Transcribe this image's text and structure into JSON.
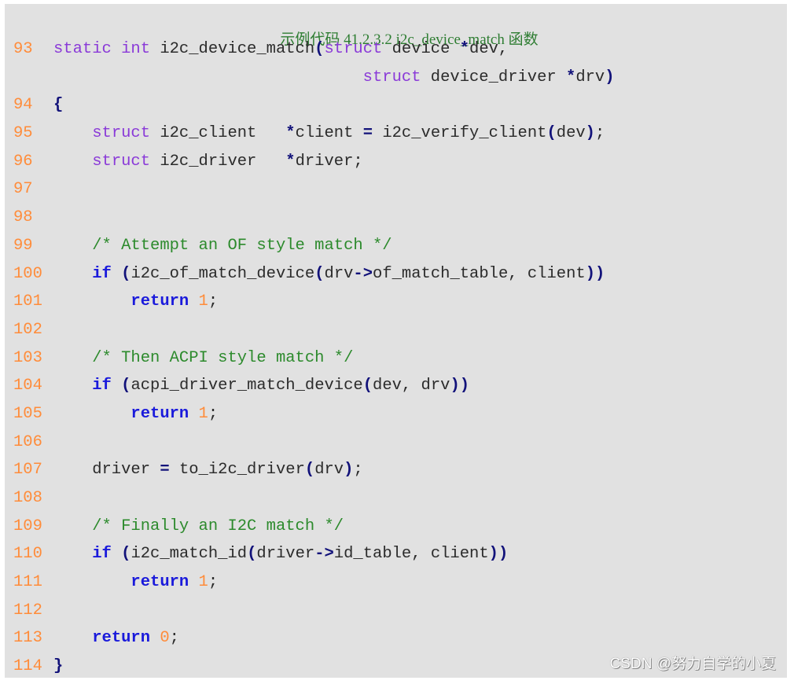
{
  "caption": "示例代码 41.2.3.2 i2c_device_match 函数",
  "watermark": "CSDN @努力自学的小夏",
  "colors": {
    "background": "#e1e1e1",
    "line_number": "#ff8c3a",
    "type_keyword": "#8a3ad8",
    "control_keyword": "#1a1adb",
    "operator": "#12127a",
    "comment": "#2c8a2c",
    "caption": "#2e7d32"
  },
  "lines": [
    {
      "num": "93",
      "tokens": [
        {
          "t": "static int",
          "c": "kw-type"
        },
        {
          "t": " i2c_device_match",
          "c": ""
        },
        {
          "t": "(",
          "c": "op"
        },
        {
          "t": "struct",
          "c": "kw-type"
        },
        {
          "t": " device ",
          "c": ""
        },
        {
          "t": "*",
          "c": "op"
        },
        {
          "t": "dev,",
          "c": ""
        }
      ]
    },
    {
      "num": "",
      "tokens": [
        {
          "t": "                                ",
          "c": ""
        },
        {
          "t": "struct",
          "c": "kw-type"
        },
        {
          "t": " device_driver ",
          "c": ""
        },
        {
          "t": "*",
          "c": "op"
        },
        {
          "t": "drv",
          "c": ""
        },
        {
          "t": ")",
          "c": "op"
        }
      ]
    },
    {
      "num": "94",
      "tokens": [
        {
          "t": "{",
          "c": "op"
        }
      ]
    },
    {
      "num": "95",
      "tokens": [
        {
          "t": "    ",
          "c": ""
        },
        {
          "t": "struct",
          "c": "kw-type"
        },
        {
          "t": " i2c_client   ",
          "c": ""
        },
        {
          "t": "*",
          "c": "op"
        },
        {
          "t": "client ",
          "c": ""
        },
        {
          "t": "=",
          "c": "op"
        },
        {
          "t": " i2c_verify_client",
          "c": ""
        },
        {
          "t": "(",
          "c": "op"
        },
        {
          "t": "dev",
          "c": ""
        },
        {
          "t": ")",
          "c": "op"
        },
        {
          "t": ";",
          "c": ""
        }
      ]
    },
    {
      "num": "96",
      "tokens": [
        {
          "t": "    ",
          "c": ""
        },
        {
          "t": "struct",
          "c": "kw-type"
        },
        {
          "t": " i2c_driver   ",
          "c": ""
        },
        {
          "t": "*",
          "c": "op"
        },
        {
          "t": "driver;",
          "c": ""
        }
      ]
    },
    {
      "num": "97",
      "tokens": []
    },
    {
      "num": "98",
      "tokens": []
    },
    {
      "num": "99",
      "tokens": [
        {
          "t": "    ",
          "c": ""
        },
        {
          "t": "/* Attempt an OF style match */",
          "c": "cm"
        }
      ]
    },
    {
      "num": "100",
      "tokens": [
        {
          "t": "    ",
          "c": ""
        },
        {
          "t": "if",
          "c": "kw"
        },
        {
          "t": " ",
          "c": ""
        },
        {
          "t": "(",
          "c": "op"
        },
        {
          "t": "i2c_of_match_device",
          "c": ""
        },
        {
          "t": "(",
          "c": "op"
        },
        {
          "t": "drv",
          "c": ""
        },
        {
          "t": "->",
          "c": "op"
        },
        {
          "t": "of_match_table, client",
          "c": ""
        },
        {
          "t": "))",
          "c": "op"
        }
      ]
    },
    {
      "num": "101",
      "tokens": [
        {
          "t": "        ",
          "c": ""
        },
        {
          "t": "return",
          "c": "kw"
        },
        {
          "t": " ",
          "c": ""
        },
        {
          "t": "1",
          "c": "num"
        },
        {
          "t": ";",
          "c": ""
        }
      ]
    },
    {
      "num": "102",
      "tokens": []
    },
    {
      "num": "103",
      "tokens": [
        {
          "t": "    ",
          "c": ""
        },
        {
          "t": "/* Then ACPI style match */",
          "c": "cm"
        }
      ]
    },
    {
      "num": "104",
      "tokens": [
        {
          "t": "    ",
          "c": ""
        },
        {
          "t": "if",
          "c": "kw"
        },
        {
          "t": " ",
          "c": ""
        },
        {
          "t": "(",
          "c": "op"
        },
        {
          "t": "acpi_driver_match_device",
          "c": ""
        },
        {
          "t": "(",
          "c": "op"
        },
        {
          "t": "dev, drv",
          "c": ""
        },
        {
          "t": "))",
          "c": "op"
        }
      ]
    },
    {
      "num": "105",
      "tokens": [
        {
          "t": "        ",
          "c": ""
        },
        {
          "t": "return",
          "c": "kw"
        },
        {
          "t": " ",
          "c": ""
        },
        {
          "t": "1",
          "c": "num"
        },
        {
          "t": ";",
          "c": ""
        }
      ]
    },
    {
      "num": "106",
      "tokens": []
    },
    {
      "num": "107",
      "tokens": [
        {
          "t": "    driver ",
          "c": ""
        },
        {
          "t": "=",
          "c": "op"
        },
        {
          "t": " to_i2c_driver",
          "c": ""
        },
        {
          "t": "(",
          "c": "op"
        },
        {
          "t": "drv",
          "c": ""
        },
        {
          "t": ")",
          "c": "op"
        },
        {
          "t": ";",
          "c": ""
        }
      ]
    },
    {
      "num": "108",
      "tokens": []
    },
    {
      "num": "109",
      "tokens": [
        {
          "t": "    ",
          "c": ""
        },
        {
          "t": "/* Finally an I2C match */",
          "c": "cm"
        }
      ]
    },
    {
      "num": "110",
      "tokens": [
        {
          "t": "    ",
          "c": ""
        },
        {
          "t": "if",
          "c": "kw"
        },
        {
          "t": " ",
          "c": ""
        },
        {
          "t": "(",
          "c": "op"
        },
        {
          "t": "i2c_match_id",
          "c": ""
        },
        {
          "t": "(",
          "c": "op"
        },
        {
          "t": "driver",
          "c": ""
        },
        {
          "t": "->",
          "c": "op"
        },
        {
          "t": "id_table, client",
          "c": ""
        },
        {
          "t": "))",
          "c": "op"
        }
      ]
    },
    {
      "num": "111",
      "tokens": [
        {
          "t": "        ",
          "c": ""
        },
        {
          "t": "return",
          "c": "kw"
        },
        {
          "t": " ",
          "c": ""
        },
        {
          "t": "1",
          "c": "num"
        },
        {
          "t": ";",
          "c": ""
        }
      ]
    },
    {
      "num": "112",
      "tokens": []
    },
    {
      "num": "113",
      "tokens": [
        {
          "t": "    ",
          "c": ""
        },
        {
          "t": "return",
          "c": "kw"
        },
        {
          "t": " ",
          "c": ""
        },
        {
          "t": "0",
          "c": "num"
        },
        {
          "t": ";",
          "c": ""
        }
      ]
    },
    {
      "num": "114",
      "tokens": [
        {
          "t": "}",
          "c": "op"
        }
      ]
    }
  ]
}
